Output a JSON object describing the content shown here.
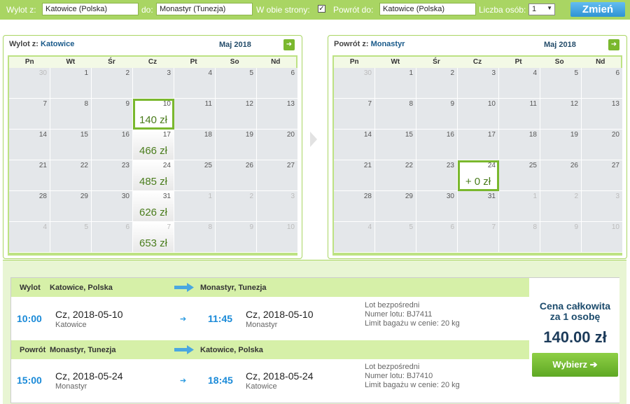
{
  "search": {
    "depart_label": "Wylot z:",
    "depart_value": "Katowice (Polska)",
    "to_label": "do:",
    "to_value": "Monastyr (Tunezja)",
    "roundtrip_label": "W obie strony:",
    "roundtrip_checked": "✓",
    "return_label": "Powrót do:",
    "return_value": "Katowice (Polska)",
    "pax_label": "Liczba osób:",
    "pax_value": "1",
    "change_label": "Zmień"
  },
  "cal_out": {
    "title_prefix": "Wylot z:",
    "title_city": "Katowice",
    "month": "Maj 2018"
  },
  "cal_ret": {
    "title_prefix": "Powrót z:",
    "title_city": "Monastyr",
    "month": "Maj 2018"
  },
  "dows": [
    "Pn",
    "Wt",
    "Śr",
    "Cz",
    "Pt",
    "So",
    "Nd"
  ],
  "out_days": [
    {
      "n": "30",
      "o": 1
    },
    {
      "n": "1"
    },
    {
      "n": "2"
    },
    {
      "n": "3"
    },
    {
      "n": "4"
    },
    {
      "n": "5"
    },
    {
      "n": "6"
    },
    {
      "n": "7"
    },
    {
      "n": "8"
    },
    {
      "n": "9"
    },
    {
      "n": "10",
      "p": "140 zł",
      "s": 1
    },
    {
      "n": "11"
    },
    {
      "n": "12"
    },
    {
      "n": "13"
    },
    {
      "n": "14"
    },
    {
      "n": "15"
    },
    {
      "n": "16"
    },
    {
      "n": "17",
      "p": "466 zł"
    },
    {
      "n": "18"
    },
    {
      "n": "19"
    },
    {
      "n": "20"
    },
    {
      "n": "21"
    },
    {
      "n": "22"
    },
    {
      "n": "23"
    },
    {
      "n": "24",
      "p": "485 zł"
    },
    {
      "n": "25"
    },
    {
      "n": "26"
    },
    {
      "n": "27"
    },
    {
      "n": "28"
    },
    {
      "n": "29"
    },
    {
      "n": "30"
    },
    {
      "n": "31",
      "p": "626 zł"
    },
    {
      "n": "1",
      "o": 1
    },
    {
      "n": "2",
      "o": 1
    },
    {
      "n": "3",
      "o": 1
    },
    {
      "n": "4",
      "o": 1
    },
    {
      "n": "5",
      "o": 1
    },
    {
      "n": "6",
      "o": 1
    },
    {
      "n": "7",
      "o": 1,
      "p": "653 zł"
    },
    {
      "n": "8",
      "o": 1
    },
    {
      "n": "9",
      "o": 1
    },
    {
      "n": "10",
      "o": 1
    }
  ],
  "ret_days": [
    {
      "n": "30",
      "o": 1
    },
    {
      "n": "1"
    },
    {
      "n": "2"
    },
    {
      "n": "3"
    },
    {
      "n": "4"
    },
    {
      "n": "5"
    },
    {
      "n": "6"
    },
    {
      "n": "7"
    },
    {
      "n": "8"
    },
    {
      "n": "9"
    },
    {
      "n": "10"
    },
    {
      "n": "11"
    },
    {
      "n": "12"
    },
    {
      "n": "13"
    },
    {
      "n": "14"
    },
    {
      "n": "15"
    },
    {
      "n": "16"
    },
    {
      "n": "17"
    },
    {
      "n": "18"
    },
    {
      "n": "19"
    },
    {
      "n": "20"
    },
    {
      "n": "21"
    },
    {
      "n": "22"
    },
    {
      "n": "23"
    },
    {
      "n": "24",
      "p": "+ 0 zł",
      "s": 1
    },
    {
      "n": "25"
    },
    {
      "n": "26"
    },
    {
      "n": "27"
    },
    {
      "n": "28"
    },
    {
      "n": "29"
    },
    {
      "n": "30"
    },
    {
      "n": "31"
    },
    {
      "n": "1",
      "o": 1
    },
    {
      "n": "2",
      "o": 1
    },
    {
      "n": "3",
      "o": 1
    },
    {
      "n": "4",
      "o": 1
    },
    {
      "n": "5",
      "o": 1
    },
    {
      "n": "6",
      "o": 1
    },
    {
      "n": "7",
      "o": 1
    },
    {
      "n": "8",
      "o": 1
    },
    {
      "n": "9",
      "o": 1
    },
    {
      "n": "10",
      "o": 1
    }
  ],
  "outbound": {
    "label": "Wylot",
    "from": "Katowice, Polska",
    "to": "Monastyr, Tunezja",
    "dep_time": "10:00",
    "dep_date": "Cz, 2018-05-10",
    "dep_city": "Katowice",
    "arr_time": "11:45",
    "arr_date": "Cz, 2018-05-10",
    "arr_city": "Monastyr",
    "info1": "Lot bezpośredni",
    "info2": "Numer lotu: BJ7411",
    "info3": "Limit bagażu w cenie: 20 kg"
  },
  "inbound": {
    "label": "Powrót",
    "from": "Monastyr, Tunezja",
    "to": "Katowice, Polska",
    "dep_time": "15:00",
    "dep_date": "Cz, 2018-05-24",
    "dep_city": "Monastyr",
    "arr_time": "18:45",
    "arr_date": "Cz, 2018-05-24",
    "arr_city": "Katowice",
    "info1": "Lot bezpośredni",
    "info2": "Numer lotu: BJ7410",
    "info3": "Limit bagażu w cenie: 20 kg"
  },
  "price": {
    "label_line1": "Cena całkowita",
    "label_line2": "za 1 osobę",
    "value": "140.00 zł",
    "choose": "Wybierz"
  }
}
